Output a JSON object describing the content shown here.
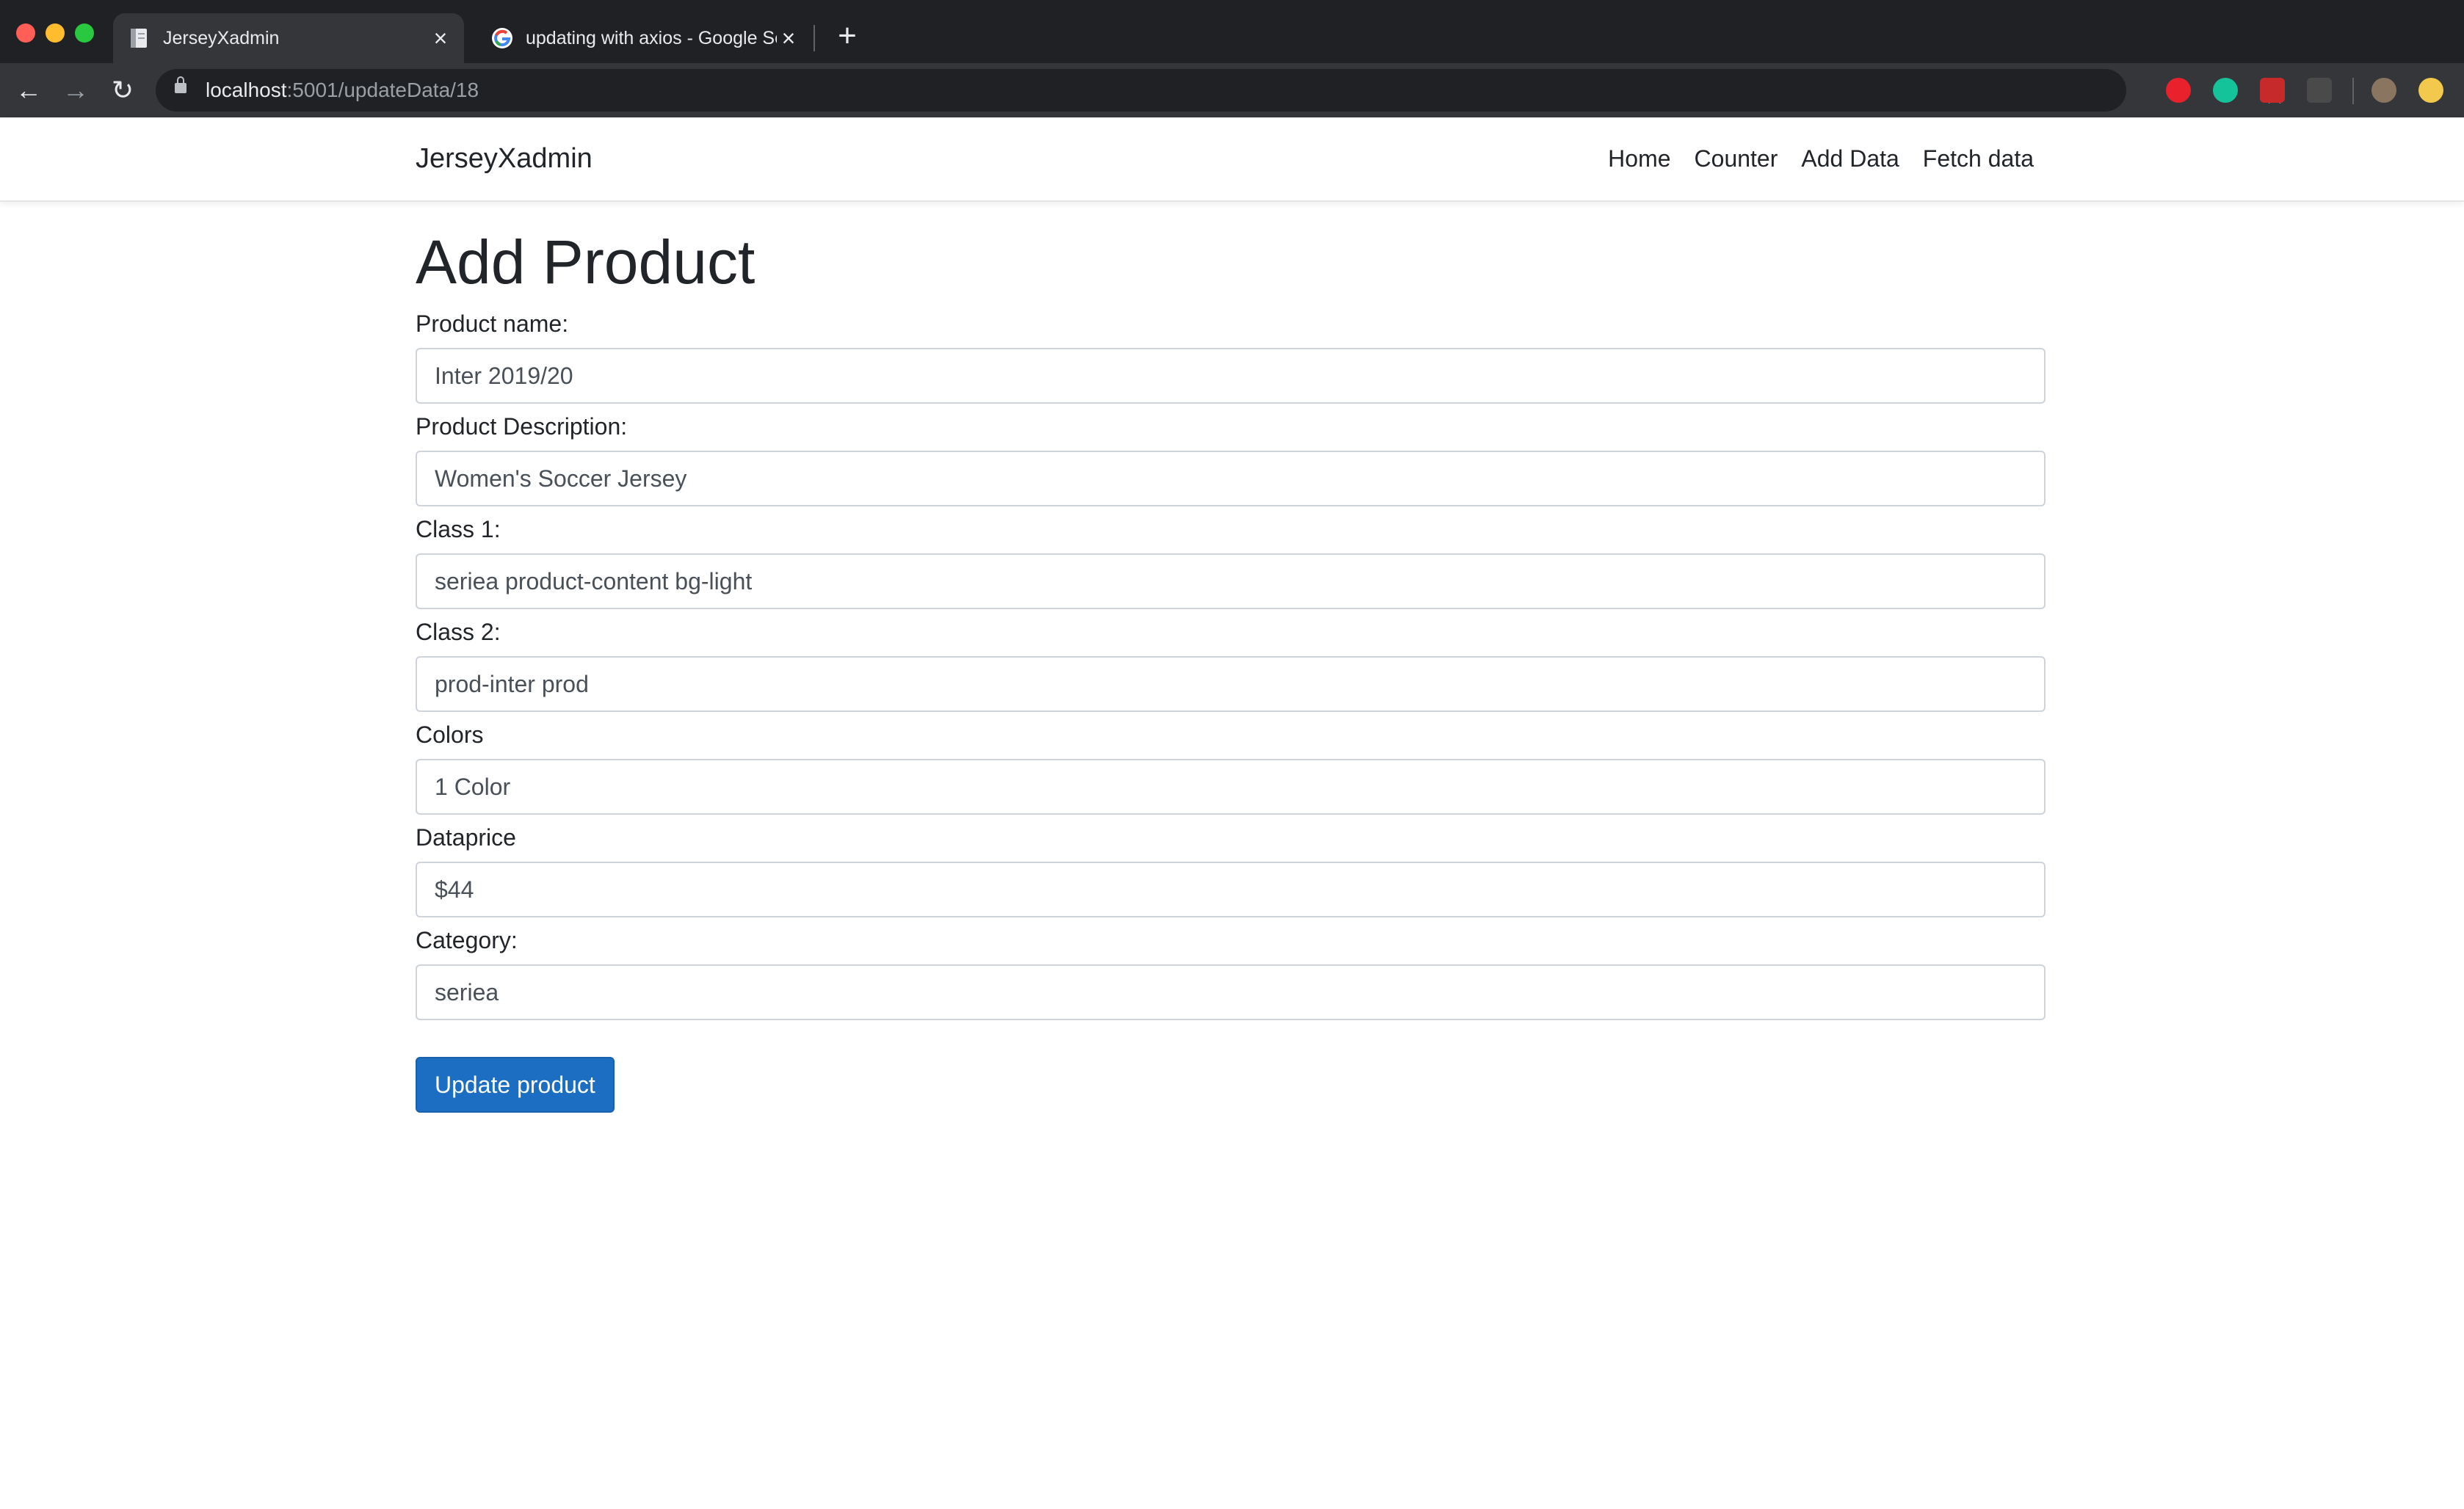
{
  "browser": {
    "tabs": [
      {
        "title": "JerseyXadmin",
        "favicon": "document-icon",
        "active": true
      },
      {
        "title": "updating with axios - Google Search",
        "favicon": "google-icon",
        "active": false
      }
    ],
    "address": {
      "host": "localhost",
      "path": ":5001/updateData/18"
    },
    "extensions": [
      "adblock-icon",
      "grammarly-icon",
      "extension-icon",
      "code-extension-icon"
    ]
  },
  "navbar": {
    "brand": "JerseyXadmin",
    "links": [
      "Home",
      "Counter",
      "Add Data",
      "Fetch data"
    ]
  },
  "form": {
    "heading": "Add Product",
    "fields": [
      {
        "label": "Product name:",
        "value": "Inter 2019/20"
      },
      {
        "label": "Product Description:",
        "value": "Women's Soccer Jersey"
      },
      {
        "label": "Class 1:",
        "value": "seriea product-content bg-light"
      },
      {
        "label": "Class 2:",
        "value": "prod-inter prod"
      },
      {
        "label": "Colors",
        "value": "1 Color"
      },
      {
        "label": "Dataprice",
        "value": "$44"
      },
      {
        "label": "Category:",
        "value": "seriea"
      }
    ],
    "submit_label": "Update product"
  },
  "colors": {
    "accent": "#1b6ec2",
    "titlebar": "#202124",
    "toolbar": "#35363a"
  }
}
